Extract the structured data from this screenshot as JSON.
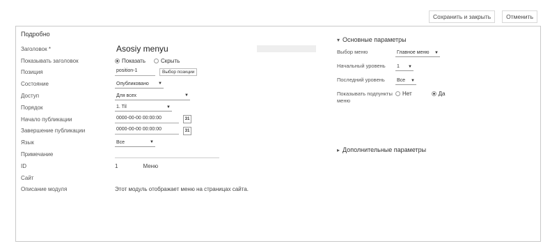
{
  "toolbar": {
    "save_close": "Сохранить и закрыть",
    "cancel": "Отменить"
  },
  "details": {
    "heading": "Подробно",
    "title_label": "Заголовок *",
    "title_value": "Asosiy menyu",
    "show_title_label": "Показывать заголовок",
    "show_option": "Показать",
    "hide_option": "Скрыть",
    "position_label": "Позиция",
    "position_value": "position-1",
    "position_button": "Выбор позиции",
    "state_label": "Состояние",
    "state_value": "Опубликовано",
    "access_label": "Доступ",
    "access_value": "Для всех",
    "order_label": "Порядок",
    "order_value": "1. Til",
    "publish_start_label": "Начало публикации",
    "publish_start_value": "0000-00-00 00:00:00",
    "publish_end_label": "Завершение публикации",
    "publish_end_value": "0000-00-00 00:00:00",
    "calendar_text": "31",
    "language_label": "Язык",
    "language_value": "Все",
    "note_label": "Примечание",
    "id_label": "ID",
    "id_value": "1",
    "id_type": "Меню",
    "site_label": "Сайт",
    "desc_label": "Описание модуля",
    "desc_value": "Этот модуль отображает меню на страницах сайта."
  },
  "basic": {
    "heading": "Основные параметры",
    "menu_label": "Выбор меню",
    "menu_value": "Главное меню",
    "start_level_label": "Начальный уровень",
    "start_level_value": "1",
    "end_level_label": "Последний уровень",
    "end_level_value": "Все",
    "show_sub_label": "Показывать подпункты меню",
    "no_option": "Нет",
    "yes_option": "Да"
  },
  "advanced": {
    "heading": "Дополнительные параметры"
  }
}
